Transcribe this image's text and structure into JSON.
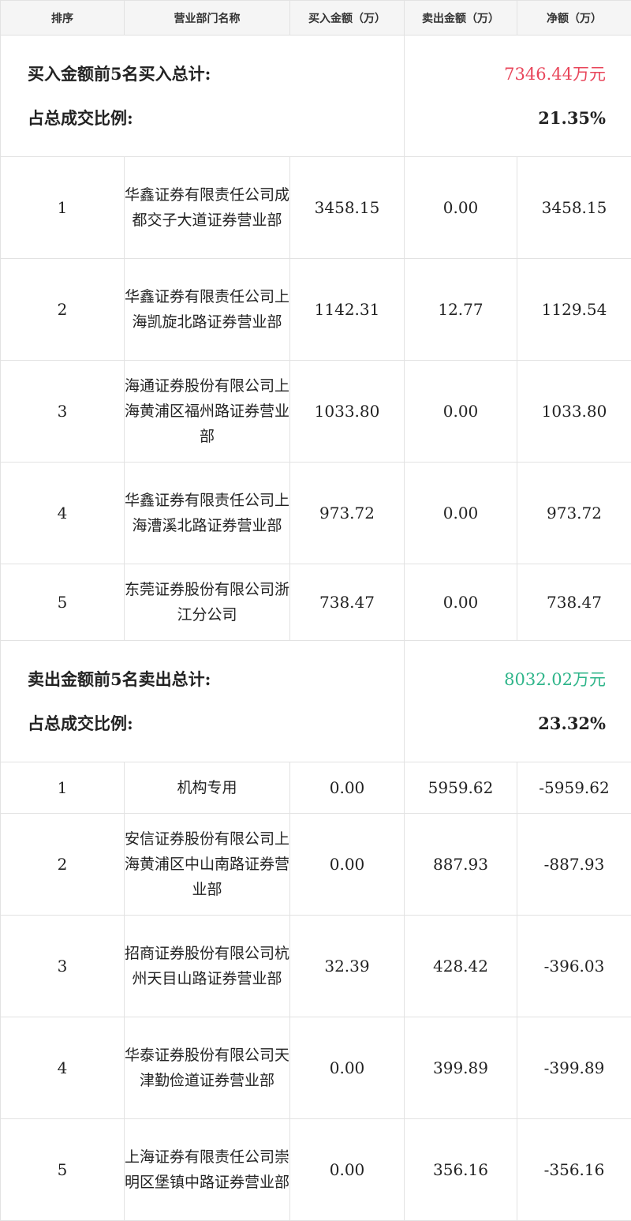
{
  "headers": [
    "排序",
    "营业部门名称",
    "买入金额（万）",
    "卖出金额（万）",
    "净额（万）"
  ],
  "buy_summary": {
    "total_label": "买入金额前5名买入总计:",
    "total_value": "7346.44万元",
    "ratio_label": "占总成交比例:",
    "ratio_value": "21.35%"
  },
  "buy_rows": [
    {
      "rank": "1",
      "name": "华鑫证券有限责任公司成都交子大道证券营业部",
      "buy": "3458.15",
      "sell": "0.00",
      "net": "3458.15"
    },
    {
      "rank": "2",
      "name": "华鑫证券有限责任公司上海凯旋北路证券营业部",
      "buy": "1142.31",
      "sell": "12.77",
      "net": "1129.54"
    },
    {
      "rank": "3",
      "name": "海通证券股份有限公司上海黄浦区福州路证券营业部",
      "buy": "1033.80",
      "sell": "0.00",
      "net": "1033.80"
    },
    {
      "rank": "4",
      "name": "华鑫证券有限责任公司上海漕溪北路证券营业部",
      "buy": "973.72",
      "sell": "0.00",
      "net": "973.72"
    },
    {
      "rank": "5",
      "name": "东莞证券股份有限公司浙江分公司",
      "buy": "738.47",
      "sell": "0.00",
      "net": "738.47"
    }
  ],
  "sell_summary": {
    "total_label": "卖出金额前5名卖出总计:",
    "total_value": "8032.02万元",
    "ratio_label": "占总成交比例:",
    "ratio_value": "23.32%"
  },
  "sell_rows": [
    {
      "rank": "1",
      "name": "机构专用",
      "buy": "0.00",
      "sell": "5959.62",
      "net": "-5959.62"
    },
    {
      "rank": "2",
      "name": "安信证券股份有限公司上海黄浦区中山南路证券营业部",
      "buy": "0.00",
      "sell": "887.93",
      "net": "-887.93"
    },
    {
      "rank": "3",
      "name": "招商证券股份有限公司杭州天目山路证券营业部",
      "buy": "32.39",
      "sell": "428.42",
      "net": "-396.03"
    },
    {
      "rank": "4",
      "name": "华泰证券股份有限公司天津勤俭道证券营业部",
      "buy": "0.00",
      "sell": "399.89",
      "net": "-399.89"
    },
    {
      "rank": "5",
      "name": "上海证券有限责任公司崇明区堡镇中路证券营业部",
      "buy": "0.00",
      "sell": "356.16",
      "net": "-356.16"
    }
  ]
}
